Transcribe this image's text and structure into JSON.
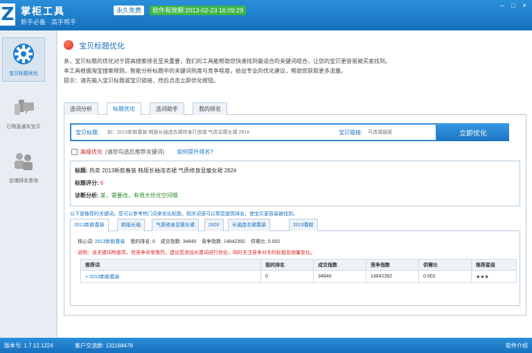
{
  "titlebar": {
    "logo": "Z",
    "app_name": "掌柜工具",
    "slogan": "新手必备 · 高手帮手",
    "badge_version": "永久免费",
    "badge_expiry": "软件有效期:2013-02-23 16:09:29",
    "controls": [
      "–",
      "□",
      "×"
    ]
  },
  "sidebar": {
    "items": [
      {
        "label": "宝贝标题优化",
        "icon": "gear-icon",
        "active": true
      },
      {
        "label": "已购直通车宝贝",
        "icon": "customer-service-icon",
        "active": false
      },
      {
        "label": "店铺排名查询",
        "icon": "users-icon",
        "active": false
      }
    ]
  },
  "page": {
    "title": "宝贝标题优化",
    "intro_lines": [
      "亲，宝贝标题的优化对于提高搜索排名至关重要，我们的工具能帮助您快速找到最适合的关键词组合，让您的宝贝更容易被买家找到。",
      "本工具根据淘宝搜索规则，智能分析标题中的关键词热度与竞争程度，给出专业的优化建议，帮助您获取更多流量。",
      "提示：请先输入宝贝标题或宝贝链接，然后点击立即优化按钮。"
    ]
  },
  "tabs": [
    "选词分析",
    "标题优化",
    "选词助手",
    "我的排名"
  ],
  "active_tab": 1,
  "search": {
    "label": "宝贝标题:",
    "placeholder": "如：2013新款春装 韩版长袖连衣裙修身打底裙 气质显瘦女裙 281#",
    "label2": "宝贝链接:",
    "placeholder2": "可选填链接",
    "button": "立即优化"
  },
  "options": {
    "checkbox_label": "高级优化",
    "checkbox_note": "(请您勾选后推荐关键词)",
    "link": "如何提升排名?"
  },
  "result": {
    "title_label": "标题:",
    "title_value": "热卖 2013新款春装 韩版长袖连衣裙 气质修身显瘦女裙 282#",
    "score_label": "标题评分:",
    "score_value": "6",
    "analysis_label": "诊断分析:",
    "analysis_value": "差，需要改，有很大优化空间哦"
  },
  "tip": "以下是推荐的关键词，您可以参考热门词来优化标题，相关词语可以帮您提高排名，使宝贝更容易被找到。",
  "subtabs": [
    "2013新款春装",
    "韩版长袖",
    "气质修身显瘦女裙",
    "282#",
    "长袖连衣裙春装",
    "2013春款"
  ],
  "active_subtab": 0,
  "core": {
    "label_core": "核心词:",
    "core_value": "2013新款春装",
    "label_rank": "我的排名:",
    "rank_value": "0",
    "label_volume": "成交指数:",
    "volume_value": "34840",
    "label_competition": "竞争指数:",
    "competition_value": "14842392",
    "label_ratio": "供需比:",
    "ratio_value": "0.002"
  },
  "warning": "说明：该关键词热度高，但竞争非常激烈，建议您添加长尾词进行优化，同时关注竞争对手的标题及销量变化。",
  "table": {
    "headers": [
      "推荐词",
      "我的排名",
      "成交指数",
      "竞争指数",
      "供需比",
      "推荐星级"
    ],
    "rows": [
      [
        "+ 2013新款春装",
        "0",
        "34840",
        "14842392",
        "0.002",
        "★★★"
      ]
    ]
  },
  "statusbar": {
    "version": "版本号: 1.7.12.1224",
    "contact": "客户交流群: 131168478",
    "right": "软件介绍"
  },
  "colors": {
    "brand_blue": "#1670bd",
    "accent_red": "#d22222",
    "accent_green": "#3db54a"
  }
}
